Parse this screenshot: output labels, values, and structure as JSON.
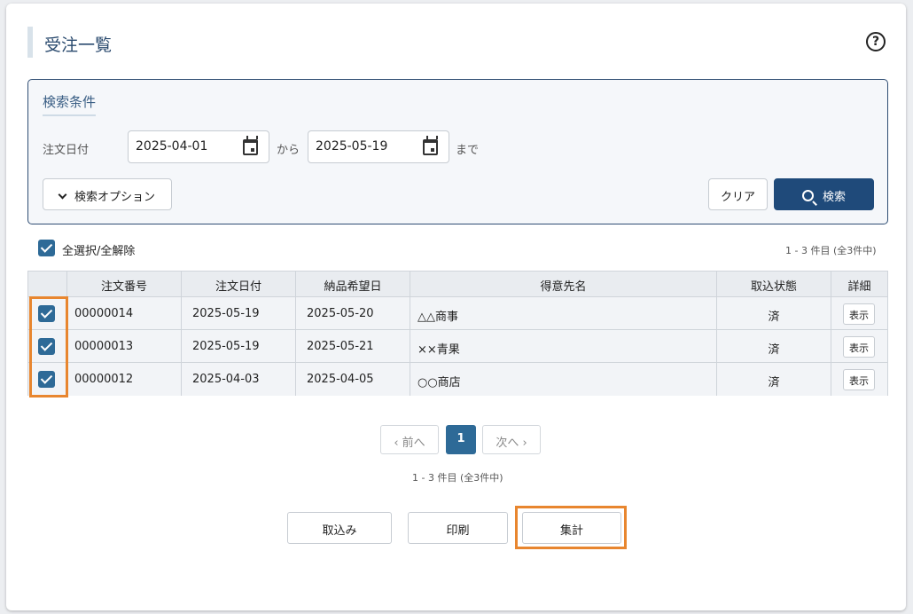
{
  "header": {
    "title": "受注一覧",
    "help_icon": "?"
  },
  "search": {
    "title": "検索条件",
    "date_label": "注文日付",
    "date_from": "2025-04-01",
    "date_sep": "から",
    "date_to": "2025-05-19",
    "date_suffix": "まで",
    "options_label": "検索オプション",
    "clear_label": "クリア",
    "search_label": "検索"
  },
  "list": {
    "select_all_label": "全選択/全解除",
    "count_text": "1 - 3 件目 (全3件中)",
    "columns": [
      "注文番号",
      "注文日付",
      "納品希望日",
      "得意先名",
      "取込状態",
      "詳細"
    ],
    "rows": [
      {
        "order_no": "00000014",
        "order_date": "2025-05-19",
        "delivery_date": "2025-05-20",
        "customer": "△△商事",
        "status": "済",
        "detail": "表示"
      },
      {
        "order_no": "00000013",
        "order_date": "2025-05-19",
        "delivery_date": "2025-05-21",
        "customer": "××青果",
        "status": "済",
        "detail": "表示"
      },
      {
        "order_no": "00000012",
        "order_date": "2025-04-03",
        "delivery_date": "2025-04-05",
        "customer": "○○商店",
        "status": "済",
        "detail": "表示"
      }
    ]
  },
  "pager": {
    "prev": "前へ",
    "current": "1",
    "next": "次へ",
    "count_text": "1 - 3 件目 (全3件中)"
  },
  "actions": {
    "import": "取込み",
    "print": "印刷",
    "total": "集計"
  },
  "colors": {
    "primary": "#1f4a7a",
    "checkbox": "#2e6a97",
    "highlight": "#e8862f"
  }
}
